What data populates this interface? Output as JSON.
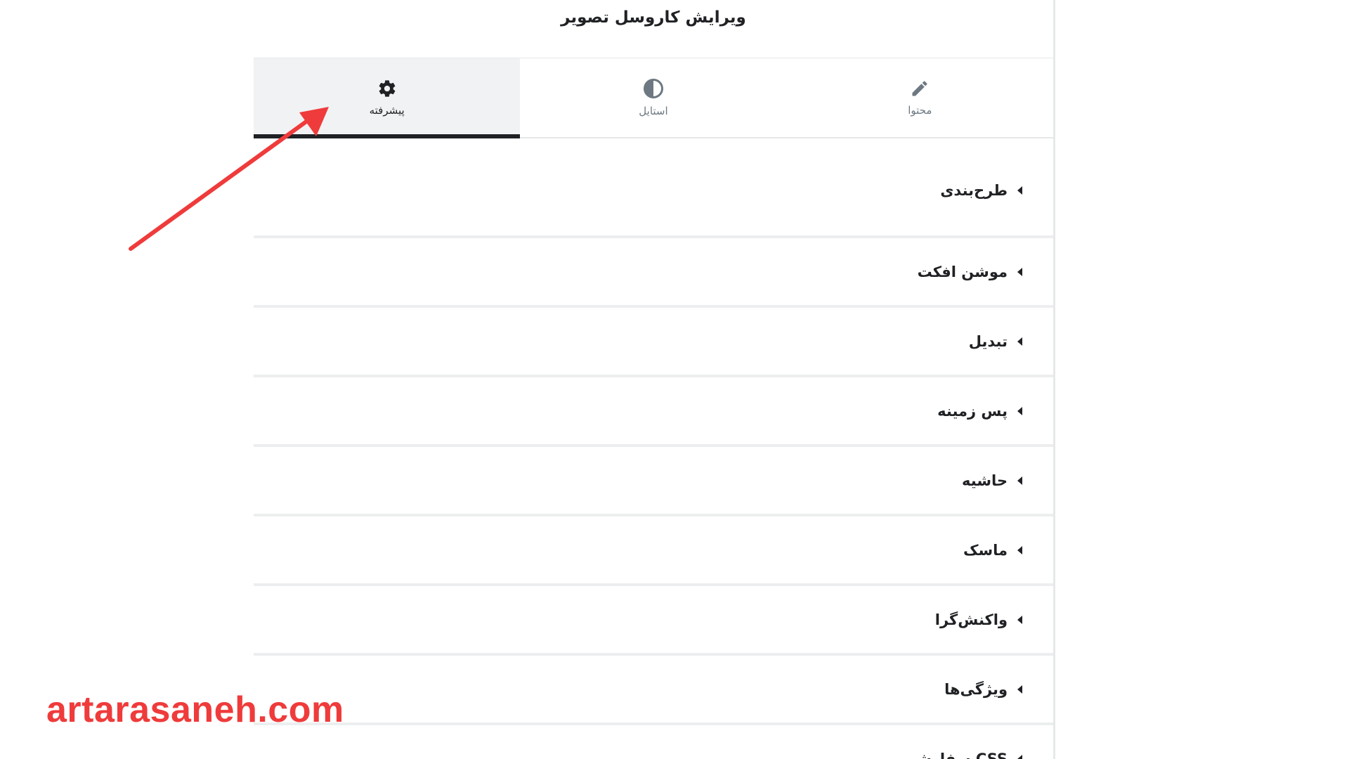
{
  "panel": {
    "title": "ویرایش کاروسل تصویر"
  },
  "tabs": [
    {
      "label": "پیشرفته",
      "icon": "gear-icon",
      "active": true
    },
    {
      "label": "استایل",
      "icon": "half-circle-icon",
      "active": false
    },
    {
      "label": "محتوا",
      "icon": "pencil-icon",
      "active": false
    }
  ],
  "sections": [
    {
      "label": "طرح‌بندی"
    },
    {
      "label": "موشن افکت"
    },
    {
      "label": "تبدیل"
    },
    {
      "label": "پس زمینه"
    },
    {
      "label": "حاشیه"
    },
    {
      "label": "ماسک"
    },
    {
      "label": "واکنش‌گرا"
    },
    {
      "label": "ویژگی‌ها"
    },
    {
      "label": "CSS سفارشی"
    }
  ],
  "annotation": {
    "arrow_color": "#ef3b3b"
  },
  "watermark": {
    "text": "artarasaneh.com",
    "color": "#ef3b3b"
  }
}
